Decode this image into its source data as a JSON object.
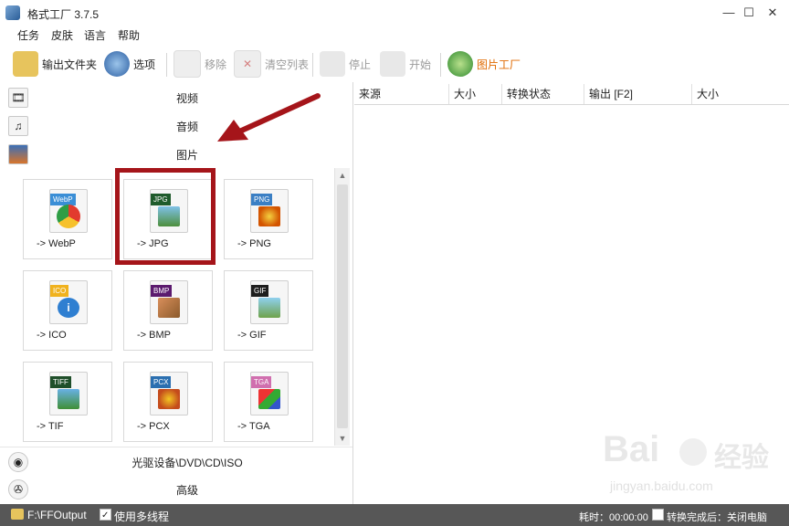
{
  "window": {
    "title": "格式工厂 3.7.5"
  },
  "menu": [
    "任务",
    "皮肤",
    "语言",
    "帮助"
  ],
  "toolbar": {
    "output_folder": "输出文件夹",
    "options": "选项",
    "remove": "移除",
    "clear_list": "清空列表",
    "stop": "停止",
    "start": "开始",
    "image_factory": "图片工厂"
  },
  "categories": {
    "video": "视频",
    "audio": "音频",
    "image": "图片",
    "rom": "光驱设备\\DVD\\CD\\ISO",
    "advanced": "高级"
  },
  "tiles": [
    {
      "tag": "WebP",
      "label": "-> WebP"
    },
    {
      "tag": "JPG",
      "label": "-> JPG"
    },
    {
      "tag": "PNG",
      "label": "-> PNG"
    },
    {
      "tag": "ICO",
      "label": "-> ICO"
    },
    {
      "tag": "BMP",
      "label": "-> BMP"
    },
    {
      "tag": "GIF",
      "label": "-> GIF"
    },
    {
      "tag": "TIFF",
      "label": "-> TIF"
    },
    {
      "tag": "PCX",
      "label": "-> PCX"
    },
    {
      "tag": "TGA",
      "label": "-> TGA"
    }
  ],
  "table": {
    "columns": [
      "来源",
      "大小",
      "转换状态",
      "输出 [F2]",
      "大小"
    ]
  },
  "status": {
    "output_path": "F:\\FFOutput",
    "multithread": "使用多线程",
    "elapsed": "耗时：00:00:00",
    "after_done": "转换完成后：关闭电脑"
  },
  "watermark": {
    "brand": "Bai",
    "brand2": "经验",
    "url": "jingyan.baidu.com"
  },
  "colors": {
    "highlight": "#a5151a",
    "statusbar": "#575757"
  }
}
